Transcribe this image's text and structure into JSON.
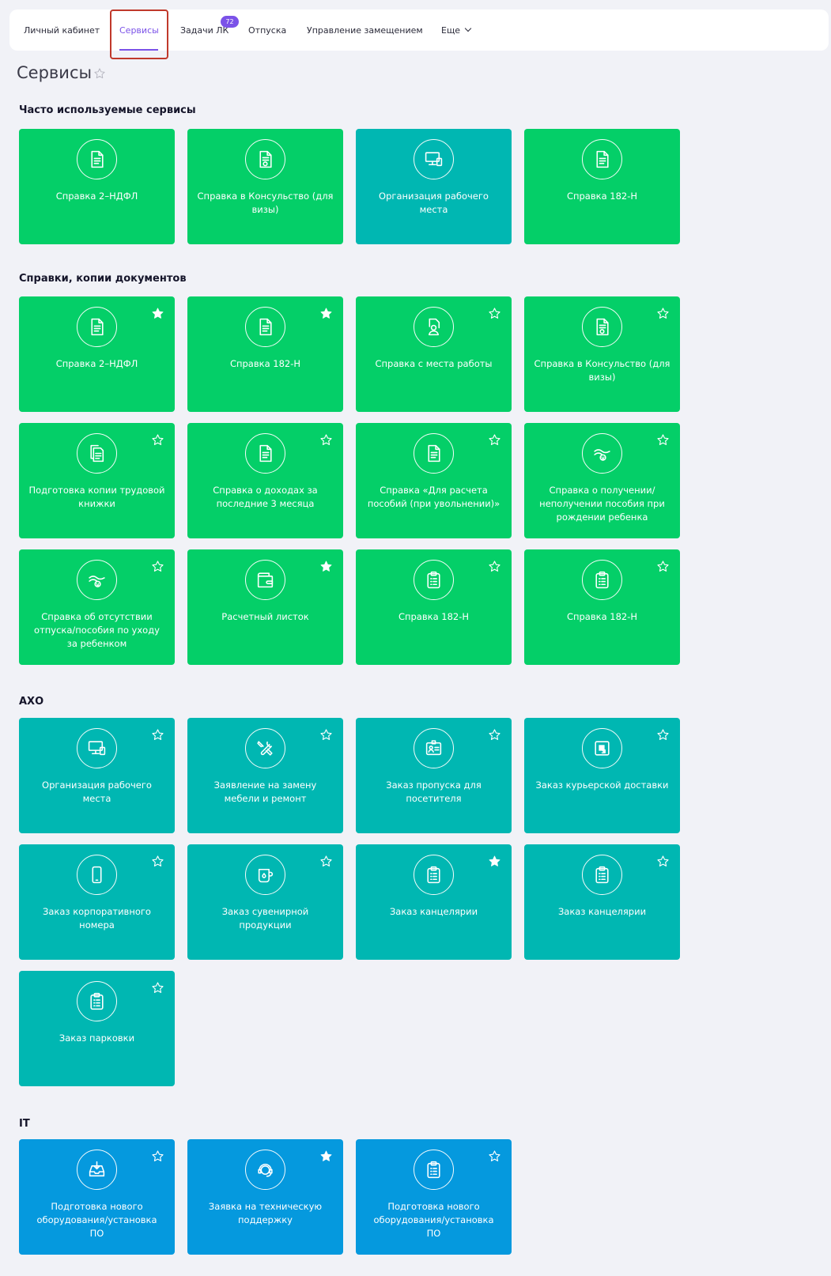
{
  "nav": {
    "items": [
      "Личный кабинет",
      "Сервисы",
      "Задачи ЛК",
      "Отпуска",
      "Управление замещением",
      "Еще"
    ],
    "badge": "72"
  },
  "page": {
    "title": "Сервисы"
  },
  "sections": [
    {
      "title": "Часто используемые сервисы",
      "cards": [
        {
          "label": "Справка 2–НДФЛ",
          "color": "#04cf68",
          "icon": "document-icon"
        },
        {
          "label": "Справка в Консульство (для визы)",
          "color": "#04cf68",
          "icon": "stamped-document-icon"
        },
        {
          "label": "Организация рабочего места",
          "color": "#00b7b2",
          "icon": "workstation-icon"
        },
        {
          "label": "Справка 182-Н",
          "color": "#04cf68",
          "icon": "document-icon"
        }
      ]
    },
    {
      "title": "Справки, копии документов",
      "cards": [
        {
          "label": "Справка 2–НДФЛ",
          "color": "#04cf68",
          "icon": "document-icon",
          "favorite": true
        },
        {
          "label": "Справка 182-Н",
          "color": "#04cf68",
          "icon": "document-icon",
          "favorite": true
        },
        {
          "label": "Справка с места работы",
          "color": "#04cf68",
          "icon": "employee-document-icon",
          "favorite": false
        },
        {
          "label": "Справка в Консульство (для визы)",
          "color": "#04cf68",
          "icon": "stamped-document-icon",
          "favorite": false
        },
        {
          "label": "Подготовка копии трудовой книжки",
          "color": "#04cf68",
          "icon": "copy-documents-icon",
          "favorite": false
        },
        {
          "label": "Справка о доходах за последние 3 месяца",
          "color": "#04cf68",
          "icon": "document-icon",
          "favorite": false
        },
        {
          "label": "Справка «Для расчета пособий (при увольнении)»",
          "color": "#04cf68",
          "icon": "document-icon",
          "favorite": false
        },
        {
          "label": "Справка о получении/ неполучении пособия при рождении ребенка",
          "color": "#04cf68",
          "icon": "baby-hand-icon",
          "favorite": false
        },
        {
          "label": "Справка об отсутствии отпуска/пособия по уходу за ребенком",
          "color": "#04cf68",
          "icon": "baby-hand-icon",
          "favorite": false
        },
        {
          "label": "Расчетный листок",
          "color": "#04cf68",
          "icon": "wallet-icon",
          "favorite": true
        },
        {
          "label": "Справка 182-Н",
          "color": "#04cf68",
          "icon": "clipboard-icon",
          "favorite": false
        },
        {
          "label": "Справка 182-Н",
          "color": "#04cf68",
          "icon": "clipboard-icon",
          "favorite": false
        }
      ]
    },
    {
      "title": "АХО",
      "cards": [
        {
          "label": "Организация рабочего места",
          "color": "#00b7b2",
          "icon": "workstation-icon",
          "favorite": false
        },
        {
          "label": "Заявление на замену мебели и ремонт",
          "color": "#00b7b2",
          "icon": "tools-icon",
          "favorite": false
        },
        {
          "label": "Заказ пропуска для посетителя",
          "color": "#00b7b2",
          "icon": "badge-icon",
          "favorite": false
        },
        {
          "label": "Заказ курьерской доставки",
          "color": "#00b7b2",
          "icon": "courier-icon",
          "favorite": false
        },
        {
          "label": "Заказ корпоративного номера",
          "color": "#00b7b2",
          "icon": "phone-icon",
          "favorite": false
        },
        {
          "label": "Заказ сувенирной продукции",
          "color": "#00b7b2",
          "icon": "mug-icon",
          "favorite": false
        },
        {
          "label": "Заказ канцелярии",
          "color": "#00b7b2",
          "icon": "clipboard-icon",
          "favorite": true
        },
        {
          "label": "Заказ канцелярии",
          "color": "#00b7b2",
          "icon": "clipboard-icon",
          "favorite": false
        },
        {
          "label": "Заказ парковки",
          "color": "#00b7b2",
          "icon": "clipboard-icon",
          "favorite": false
        }
      ]
    },
    {
      "title": "IT",
      "cards": [
        {
          "label": "Подготовка нового оборудования/установка ПО",
          "color": "#0599de",
          "icon": "download-tray-icon",
          "favorite": false
        },
        {
          "label": "Заявка на техническую поддержку",
          "color": "#0599de",
          "icon": "headset-icon",
          "favorite": true
        },
        {
          "label": "Подготовка нового оборудования/установка ПО",
          "color": "#0599de",
          "icon": "clipboard-icon",
          "favorite": false
        }
      ]
    }
  ]
}
